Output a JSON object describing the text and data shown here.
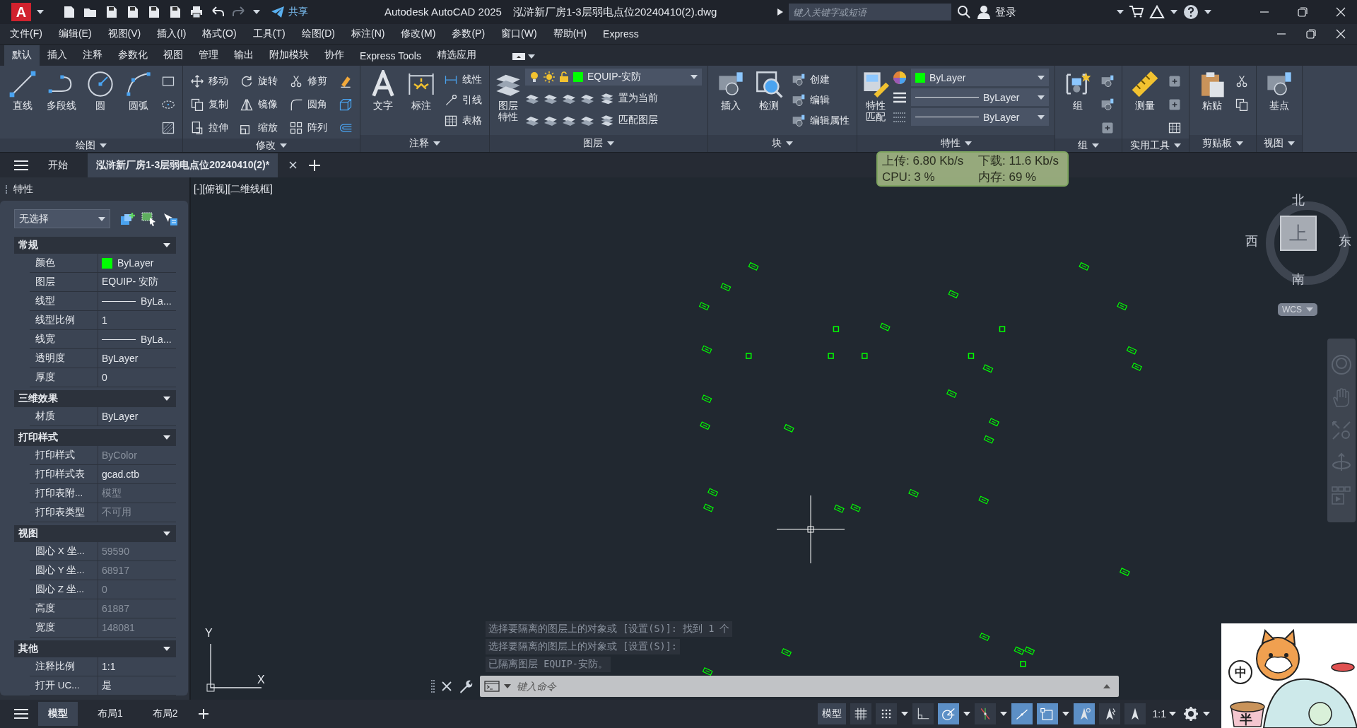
{
  "title_bar": {
    "logo": "A",
    "share": "共享",
    "app": "Autodesk AutoCAD 2025",
    "file": "泓浒新厂房1-3层弱电点位20240410(2).dwg",
    "search": {
      "placeholder": "键入关键字或短语"
    },
    "login": "登录"
  },
  "menu_bar": [
    "文件(F)",
    "编辑(E)",
    "视图(V)",
    "插入(I)",
    "格式(O)",
    "工具(T)",
    "绘图(D)",
    "标注(N)",
    "修改(M)",
    "参数(P)",
    "窗口(W)",
    "帮助(H)",
    "Express"
  ],
  "ribbon_tabs": [
    {
      "label": "默认",
      "selected": true
    },
    {
      "label": "插入",
      "selected": false
    },
    {
      "label": "注释",
      "selected": false
    },
    {
      "label": "参数化",
      "selected": false
    },
    {
      "label": "视图",
      "selected": false
    },
    {
      "label": "管理",
      "selected": false
    },
    {
      "label": "输出",
      "selected": false
    },
    {
      "label": "附加模块",
      "selected": false
    },
    {
      "label": "协作",
      "selected": false
    },
    {
      "label": "Express Tools",
      "selected": false
    },
    {
      "label": "精选应用",
      "selected": false
    }
  ],
  "ribbon_panels": [
    {
      "title": "绘图",
      "large": [
        {
          "label": "直线",
          "kind": "line"
        },
        {
          "label": "多段线",
          "kind": "polyline"
        },
        {
          "label": "圆",
          "kind": "circle"
        },
        {
          "label": "圆弧",
          "kind": "arc"
        }
      ],
      "small": [
        {
          "kind": "rectangle"
        },
        {
          "kind": "ellipse"
        },
        {
          "kind": "hatch"
        }
      ]
    },
    {
      "title": "修改",
      "small": [
        {
          "label": "移动",
          "kind": "move"
        },
        {
          "label": "旋转",
          "kind": "rotate"
        },
        {
          "label": "修剪",
          "kind": "trim"
        },
        {
          "kind": "erase"
        },
        {
          "label": "复制",
          "kind": "copy"
        },
        {
          "label": "镜像",
          "kind": "mirror"
        },
        {
          "label": "圆角",
          "kind": "fillet"
        },
        {
          "kind": "cube"
        },
        {
          "label": "拉伸",
          "kind": "stretch"
        },
        {
          "label": "缩放",
          "kind": "scale"
        },
        {
          "label": "阵列",
          "kind": "array"
        },
        {
          "kind": "offset"
        }
      ]
    },
    {
      "title": "注释",
      "large": [
        {
          "label": "文字",
          "kind": "text"
        },
        {
          "label": "标注",
          "kind": "dimension"
        }
      ],
      "small": [
        {
          "label": "线性",
          "kind": "linear"
        },
        {
          "label": "引线",
          "kind": "leader"
        },
        {
          "label": "表格",
          "kind": "table"
        }
      ]
    },
    {
      "title": "图层",
      "large": [
        {
          "label": "图层特性",
          "kind": "layers"
        }
      ],
      "layer": {
        "name": "EQUIP-安防",
        "color": "#00ff00"
      },
      "small": [
        {
          "label": "置为当前",
          "kind": "set-current"
        },
        {
          "label": "匹配图层",
          "kind": "match-layer"
        }
      ]
    },
    {
      "title": "块",
      "large": [
        {
          "label": "插入",
          "kind": "insert"
        },
        {
          "label": "检测",
          "kind": "inspect"
        }
      ],
      "small": [
        {
          "label": "创建",
          "kind": "create"
        },
        {
          "label": "编辑",
          "kind": "edit"
        },
        {
          "label": "编辑属性",
          "kind": "attribute"
        }
      ]
    },
    {
      "title": "特性",
      "large": [
        {
          "label": "特性匹配",
          "kind": "match-props"
        }
      ],
      "props": [
        {
          "kind": "color",
          "value": "ByLayer",
          "color": "#00ff00"
        },
        {
          "kind": "linetype",
          "value": "ByLayer"
        },
        {
          "kind": "lineweight",
          "value": "ByLayer"
        }
      ]
    },
    {
      "title": "组",
      "large": [
        {
          "label": "组",
          "kind": "group"
        }
      ],
      "small": [
        {
          "kind": "ungroup"
        },
        {
          "kind": "group-edit"
        },
        {
          "kind": "group-select"
        }
      ]
    },
    {
      "title": "实用工具",
      "large": [
        {
          "label": "测量",
          "kind": "measure"
        }
      ],
      "small": [
        {
          "kind": "quick-select"
        },
        {
          "kind": "select-all"
        },
        {
          "kind": "calculator"
        }
      ]
    },
    {
      "title": "剪贴板",
      "large": [
        {
          "label": "粘贴",
          "kind": "paste"
        }
      ],
      "small": [
        {
          "kind": "cut"
        },
        {
          "kind": "copy-clip"
        }
      ]
    },
    {
      "title": "视图",
      "large": [
        {
          "label": "基点",
          "kind": "base"
        }
      ]
    }
  ],
  "doc_tabs": [
    {
      "label": "开始",
      "selected": false
    },
    {
      "label": "泓浒新厂房1-3层弱电点位20240410(2)*",
      "selected": true
    }
  ],
  "properties": {
    "title": "特性",
    "selection": "无选择",
    "sections": [
      {
        "title": "常规",
        "rows": [
          {
            "label": "颜色",
            "value": "ByLayer",
            "kind": "color",
            "color": "#00ff00",
            "disabled": false
          },
          {
            "label": "图层",
            "value": "EQUIP- 安防",
            "kind": "text",
            "disabled": false
          },
          {
            "label": "线型",
            "value": "ByLa...",
            "kind": "line",
            "disabled": false
          },
          {
            "label": "线型比例",
            "value": "1",
            "kind": "text",
            "disabled": false
          },
          {
            "label": "线宽",
            "value": "ByLa...",
            "kind": "line",
            "disabled": false
          },
          {
            "label": "透明度",
            "value": "ByLayer",
            "kind": "text",
            "disabled": false
          },
          {
            "label": "厚度",
            "value": "0",
            "kind": "text",
            "disabled": false
          }
        ]
      },
      {
        "title": "三维效果",
        "rows": [
          {
            "label": "材质",
            "value": "ByLayer",
            "kind": "text",
            "disabled": false
          }
        ]
      },
      {
        "title": "打印样式",
        "rows": [
          {
            "label": "打印样式",
            "value": "ByColor",
            "kind": "text",
            "disabled": true
          },
          {
            "label": "打印样式表",
            "value": "gcad.ctb",
            "kind": "text",
            "disabled": false
          },
          {
            "label": "打印表附...",
            "value": "模型",
            "kind": "text",
            "disabled": true
          },
          {
            "label": "打印表类型",
            "value": "不可用",
            "kind": "text",
            "disabled": true
          }
        ]
      },
      {
        "title": "视图",
        "rows": [
          {
            "label": "圆心 X 坐...",
            "value": "59590",
            "kind": "text",
            "disabled": true
          },
          {
            "label": "圆心 Y 坐...",
            "value": "68917",
            "kind": "text",
            "disabled": true
          },
          {
            "label": "圆心 Z 坐...",
            "value": "0",
            "kind": "text",
            "disabled": true
          },
          {
            "label": "高度",
            "value": "61887",
            "kind": "text",
            "disabled": true
          },
          {
            "label": "宽度",
            "value": "148081",
            "kind": "text",
            "disabled": true
          }
        ]
      },
      {
        "title": "其他",
        "rows": [
          {
            "label": "注释比例",
            "value": "1:1",
            "kind": "text",
            "disabled": false
          },
          {
            "label": "打开 UC...",
            "value": "是",
            "kind": "text",
            "disabled": false
          }
        ]
      }
    ]
  },
  "viewport": {
    "label": "[-][俯视][二维线框]",
    "compass": {
      "north": "北",
      "south": "南",
      "east": "东",
      "west": "西",
      "top": "上"
    },
    "wcs": "WCS",
    "ucs": {
      "x": "X",
      "y": "Y"
    }
  },
  "command": {
    "history": [
      "选择要隔离的图层上的对象或 [设置(S)]: 找到 1 个",
      "选择要隔离的图层上的对象或 [设置(S)]:",
      "已隔离图层 EQUIP-安防。"
    ],
    "placeholder": "键入命令"
  },
  "network_monitor": {
    "upload": "上传: 6.80 Kb/s",
    "download": "下载: 11.6 Kb/s",
    "cpu": "CPU: 3 %",
    "memory": "内存: 69 %"
  },
  "layout_tabs": [
    {
      "label": "模型",
      "selected": true
    },
    {
      "label": "布局1",
      "selected": false
    },
    {
      "label": "布局2",
      "selected": false
    }
  ],
  "status_bar": {
    "model": "模型",
    "toggles": [
      {
        "kind": "grid",
        "on": false
      },
      {
        "kind": "snap",
        "on": false
      },
      {
        "kind": "ortho",
        "on": false
      },
      {
        "kind": "polar",
        "on": true
      },
      {
        "kind": "tracking",
        "on": false
      },
      {
        "kind": "isometric",
        "on": true
      },
      {
        "kind": "osnap",
        "on": true
      },
      {
        "kind": "annotation",
        "on": true
      },
      {
        "kind": "autoscale",
        "on": false
      },
      {
        "kind": "annoscale",
        "on": false
      }
    ],
    "scale": "1:1"
  },
  "desktop_pet": {
    "ime": "中",
    "width": "半"
  }
}
